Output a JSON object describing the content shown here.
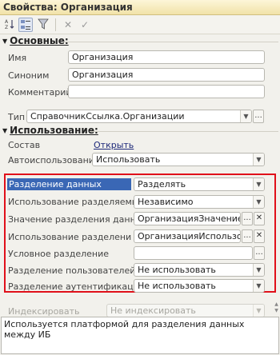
{
  "window": {
    "title": "Свойства: Организация"
  },
  "toolbar": {
    "sort_icon": "sort-az-icon",
    "categories_icon": "categories-icon",
    "filter_icon": "filter-icon",
    "close_icon": "close-icon",
    "check_icon": "check-icon"
  },
  "main_section": {
    "title": "Основные:",
    "name": {
      "label": "Имя",
      "value": "Организация"
    },
    "synonym": {
      "label": "Синоним",
      "value": "Организация"
    },
    "comment": {
      "label": "Комментарий",
      "value": ""
    },
    "type": {
      "label": "Тип",
      "value": "СправочникСсылка.Организации",
      "ellipsis": "..."
    }
  },
  "usage_section": {
    "title": "Использование:",
    "composition": {
      "label": "Состав",
      "link": "Открыть"
    },
    "autouse": {
      "label": "Автоиспользование",
      "value": "Использовать"
    },
    "data_separation": {
      "label": "Разделение данных",
      "value": "Разделять"
    },
    "separated_usage": {
      "label": "Использование разделяемых",
      "value": "Независимо"
    },
    "separation_value": {
      "label": "Значение разделения данных",
      "value": "ОрганизацияЗначение",
      "ellipsis": "..."
    },
    "separation_usage": {
      "label": "Использование разделения да",
      "value": "ОрганизацияИспользова",
      "ellipsis": "..."
    },
    "conditional": {
      "label": "Условное разделение",
      "value": "",
      "ellipsis": "..."
    },
    "user_separation": {
      "label": "Разделение пользователей",
      "value": "Не использовать"
    },
    "auth_separation": {
      "label": "Разделение аутентификации",
      "value": "Не использовать"
    },
    "indexing": {
      "label": "Индексировать",
      "value": "Не индексировать"
    }
  },
  "description": "Используется платформой для разделения данных между ИБ"
}
